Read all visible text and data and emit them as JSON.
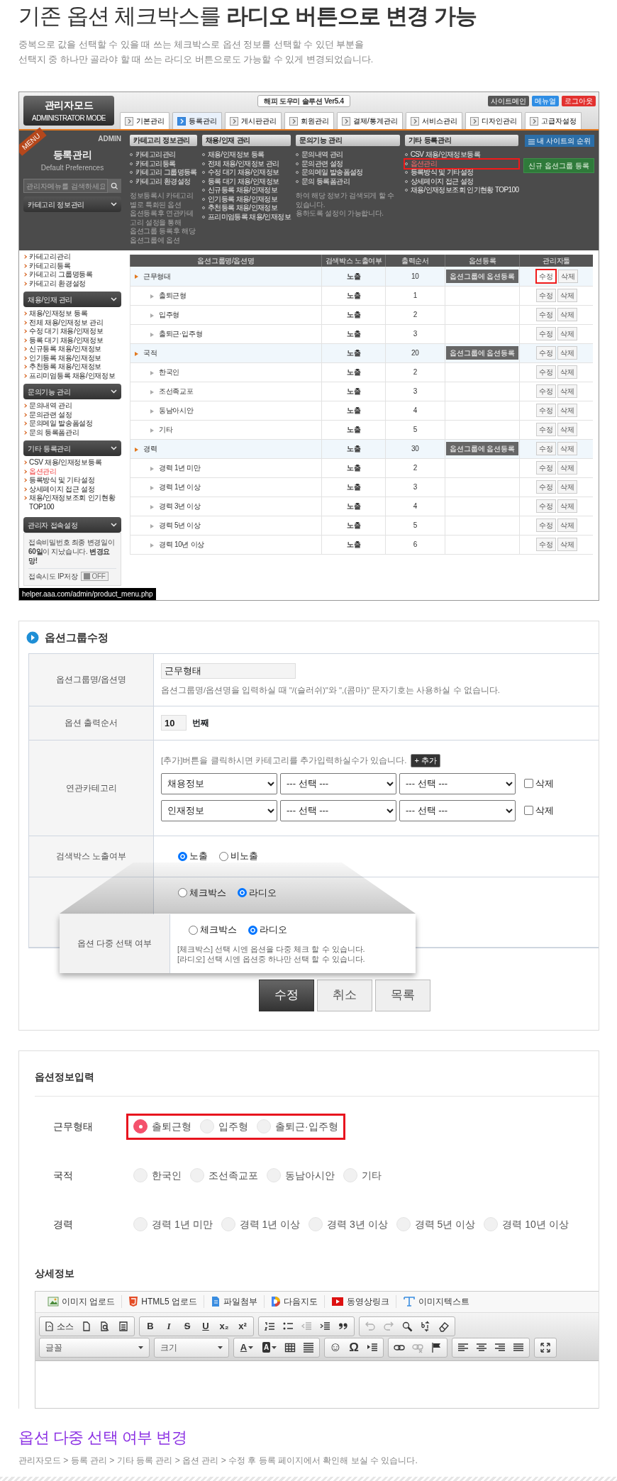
{
  "intro": {
    "title": "기존 옵션 체크박스를 **라디오 버튼으로 변경 가능**",
    "lines": [
      "중복으로 값을 선택할 수 있을 때 쓰는 체크박스로 옵션 정보를 선택할 수 있던 부분을",
      "선택지 중 하나만 골라야 할 때 쓰는 라디오 버튼으로도 가능할 수 있게 변경되었습니다."
    ]
  },
  "admin_screen": {
    "logo": {
      "title": "관리자모드",
      "subtitle": "ADMINISTRATOR MODE"
    },
    "product_title": "해피 도우미 솔루션 Ver5.4",
    "top_buttons": [
      {
        "label": "사이트메인",
        "kind": "dark"
      },
      {
        "label": "메뉴얼",
        "kind": "blue"
      },
      {
        "label": "로그아웃",
        "kind": "red"
      }
    ],
    "tabs": [
      {
        "label": "기본관리",
        "selected": false
      },
      {
        "label": "등록관리",
        "selected": true
      },
      {
        "label": "게시판관리",
        "selected": false
      },
      {
        "label": "회원관리",
        "selected": false
      },
      {
        "label": "결제/통계관리",
        "selected": false
      },
      {
        "label": "서비스관리",
        "selected": false
      },
      {
        "label": "디자인관리",
        "selected": false
      },
      {
        "label": "고급자설정",
        "selected": false
      }
    ],
    "rank_button": "내 사이트의 순위",
    "menus": [
      {
        "title": "카테고리 정보관리",
        "items": [
          {
            "label": "카테고리관리",
            "boxed": false
          },
          {
            "label": "카테고리등록",
            "boxed": false
          },
          {
            "label": "카테고리 그룹명등록",
            "boxed": false
          },
          {
            "label": "카테고리 환경설정",
            "boxed": false
          }
        ],
        "notes": [
          "정보등록시 카테고리별로 특화된 옵션",
          "옵션등록후 연관카테고리 설정을 통해",
          "옵션그룹 등록후 해당 옵션그룹에 옵션"
        ]
      },
      {
        "title": "채용/인재 관리",
        "items": [
          {
            "label": "채용/인재정보 등록",
            "boxed": false
          },
          {
            "label": "전체 채용/인재정보 관리",
            "boxed": false
          },
          {
            "label": "수정 대기 채용/인재정보",
            "boxed": false
          },
          {
            "label": "등록 대기 채용/인재정보",
            "boxed": false
          },
          {
            "label": "신규등록 채용/인재정보",
            "boxed": false
          },
          {
            "label": "인기등록 채용/인재정보",
            "boxed": false
          },
          {
            "label": "추천등록 채용/인재정보",
            "boxed": false
          },
          {
            "label": "프리미엄등록 채용/인재정보",
            "boxed": false
          }
        ]
      },
      {
        "title": "문의기능 관리",
        "items": [
          {
            "label": "문의내역 관리",
            "boxed": false
          },
          {
            "label": "문의관련 설정",
            "boxed": false
          },
          {
            "label": "문의메일 발송폼설정",
            "boxed": false
          },
          {
            "label": "문의 등록폼관리",
            "boxed": false
          }
        ],
        "notes": [
          "하여 해당 정보가 검색되게 할 수 있습니다.",
          "용하도록 설정이 가능합니다."
        ]
      },
      {
        "title": "기타 등록관리",
        "items": [
          {
            "label": "CSV 채용/인재정보등록",
            "boxed": false
          },
          {
            "label": "옵션관리",
            "boxed": true
          },
          {
            "label": "등록방식 및 기타설정",
            "boxed": false
          },
          {
            "label": "상세페이지 접근 설정",
            "boxed": false
          },
          {
            "label": "채용/인재정보조회 인기현황 TOP100",
            "boxed": false
          }
        ]
      }
    ],
    "new_group_button": "신규 옵션그룹 등록",
    "sidebar": {
      "ribbon": "MENU",
      "corner": "ADMIN",
      "title": "등록관리",
      "subtitle": "Default Preferences",
      "search_placeholder": "관리자메뉴를 검색하세요",
      "sections": [
        {
          "title": "카테고리 정보관리",
          "items": [
            {
              "label": "카테고리관리",
              "selected": false
            },
            {
              "label": "카테고리등록",
              "selected": false
            },
            {
              "label": "카테고리 그룹명등록",
              "selected": false
            },
            {
              "label": "카테고리 환경설정",
              "selected": false
            }
          ]
        },
        {
          "title": "채용/인재 관리",
          "items": [
            {
              "label": "채용/인재정보 등록",
              "selected": false
            },
            {
              "label": "전체 채용/인재정보 관리",
              "selected": false
            },
            {
              "label": "수정 대기 채용/인재정보",
              "selected": false
            },
            {
              "label": "등록 대기 채용/인재정보",
              "selected": false
            },
            {
              "label": "신규등록 채용/인재정보",
              "selected": false
            },
            {
              "label": "인기등록 채용/인재정보",
              "selected": false
            },
            {
              "label": "추천등록 채용/인재정보",
              "selected": false
            },
            {
              "label": "프리미엄등록 채용/인재정보",
              "selected": false
            }
          ]
        },
        {
          "title": "문의기능 관리",
          "items": [
            {
              "label": "문의내역 관리",
              "selected": false
            },
            {
              "label": "문의관련 설정",
              "selected": false
            },
            {
              "label": "문의메일 발송폼설정",
              "selected": false
            },
            {
              "label": "문의 등록폼관리",
              "selected": false
            }
          ]
        },
        {
          "title": "기타 등록관리",
          "items": [
            {
              "label": "CSV 채용/인재정보등록",
              "selected": false
            },
            {
              "label": "옵션관리",
              "selected": true
            },
            {
              "label": "등록방식 및 기타설정",
              "selected": false
            },
            {
              "label": "상세페이지 접근 설정",
              "selected": false
            },
            {
              "label": "채용/인재정보조회 인기현황 TOP100",
              "selected": false
            }
          ]
        }
      ],
      "access": {
        "title": "관리자 접속설정",
        "notice": "접속비밀번호 최종 변경일이 **60일**이 지났습니다. **변경요망!**",
        "ip_label": "접속시도 IP저장",
        "toggle": {
          "label": "OFF",
          "on": false
        }
      }
    },
    "table": {
      "columns": [
        "옵션그룹명/옵션명",
        "검색박스 노출여부",
        "출력순서",
        "옵션등록",
        "관리자툴"
      ],
      "rows": [
        {
          "name": "근무형태",
          "exposure": "노출",
          "order": "10",
          "register_button": "옵션그룹에 옵션등록",
          "edit": "수정",
          "delete": "삭제",
          "edit_boxed": true,
          "children": [
            {
              "name": "출퇴근형",
              "exposure": "노출",
              "order": "1",
              "edit": "수정",
              "delete": "삭제",
              "edit_boxed": false
            },
            {
              "name": "입주형",
              "exposure": "노출",
              "order": "2",
              "edit": "수정",
              "delete": "삭제",
              "edit_boxed": false
            },
            {
              "name": "출퇴근·입주형",
              "exposure": "노출",
              "order": "3",
              "edit": "수정",
              "delete": "삭제",
              "edit_boxed": false
            }
          ]
        },
        {
          "name": "국적",
          "exposure": "노출",
          "order": "20",
          "register_button": "옵션그룹에 옵션등록",
          "edit": "수정",
          "delete": "삭제",
          "edit_boxed": false,
          "children": [
            {
              "name": "한국인",
              "exposure": "노출",
              "order": "2",
              "edit": "수정",
              "delete": "삭제",
              "edit_boxed": false
            },
            {
              "name": "조선족교포",
              "exposure": "노출",
              "order": "3",
              "edit": "수정",
              "delete": "삭제",
              "edit_boxed": false
            },
            {
              "name": "동남아시안",
              "exposure": "노출",
              "order": "4",
              "edit": "수정",
              "delete": "삭제",
              "edit_boxed": false
            },
            {
              "name": "기타",
              "exposure": "노출",
              "order": "5",
              "edit": "수정",
              "delete": "삭제",
              "edit_boxed": false
            }
          ]
        },
        {
          "name": "경력",
          "exposure": "노출",
          "order": "30",
          "register_button": "옵션그룹에 옵션등록",
          "edit": "수정",
          "delete": "삭제",
          "edit_boxed": false,
          "children": [
            {
              "name": "경력 1년 미만",
              "exposure": "노출",
              "order": "2",
              "edit": "수정",
              "delete": "삭제",
              "edit_boxed": false
            },
            {
              "name": "경력 1년 이상",
              "exposure": "노출",
              "order": "3",
              "edit": "수정",
              "delete": "삭제",
              "edit_boxed": false
            },
            {
              "name": "경력 3년 이상",
              "exposure": "노출",
              "order": "4",
              "edit": "수정",
              "delete": "삭제",
              "edit_boxed": false
            },
            {
              "name": "경력 5년 이상",
              "exposure": "노출",
              "order": "5",
              "edit": "수정",
              "delete": "삭제",
              "edit_boxed": false
            },
            {
              "name": "경력 10년 이상",
              "exposure": "노출",
              "order": "6",
              "edit": "수정",
              "delete": "삭제",
              "edit_boxed": false
            }
          ]
        }
      ]
    },
    "status_bar": "helper.aaa.com/admin/product_menu.php"
  },
  "option_group_form": {
    "title": "옵션그룹수정",
    "rows": [
      {
        "kind": "name",
        "label": "옵션그룹명/옵션명",
        "value": "근무형태",
        "hint": "옵션그룹명/옵션명을 입력하실 때 \"/(슬러쉬)\"와 \",(콤마)\" 문자기호는 사용하실 수 없습니다."
      },
      {
        "kind": "order",
        "label": "옵션 출력순서",
        "value": "10",
        "suffix": "번째"
      },
      {
        "kind": "category",
        "label": "연관카테고리",
        "hint": "[추가]버튼을 클릭하시면 카테고리를 추가입력하실수가 있습니다.",
        "add_button": "+ 추가",
        "lines": [
          {
            "selects": [
              "채용정보",
              "--- 선택 ---",
              "--- 선택 ---"
            ],
            "delete": {
              "label": "삭제",
              "checked": false
            }
          },
          {
            "selects": [
              "인재정보",
              "--- 선택 ---",
              "--- 선택 ---"
            ],
            "delete": {
              "label": "삭제",
              "checked": false
            }
          }
        ]
      },
      {
        "kind": "radio",
        "label": "검색박스 노출여부",
        "options": [
          {
            "label": "노출",
            "selected": true
          },
          {
            "label": "비노출",
            "selected": false
          }
        ]
      },
      {
        "kind": "radio",
        "options": [
          {
            "label": "체크박스",
            "selected": false
          },
          {
            "label": "라디오",
            "selected": true
          }
        ]
      }
    ],
    "callout": {
      "label": "옵션 다중 선택 여부",
      "options": [
        {
          "label": "체크박스",
          "selected": false
        },
        {
          "label": "라디오",
          "selected": true
        }
      ],
      "hints": [
        "[체크박스] 선택 시엔 옵션을 다중 체크 할 수 있습니다.",
        "[라디오] 선택 시엔 옵션중 하나만 선택 할 수 있습니다."
      ]
    },
    "buttons": [
      {
        "label": "수정",
        "kind": "primary"
      },
      {
        "label": "취소",
        "kind": "plain"
      },
      {
        "label": "목록",
        "kind": "plain"
      }
    ]
  },
  "option_input": {
    "title": "옵션정보입력",
    "groups": [
      {
        "label": "근무형태",
        "boxed": true,
        "options": [
          {
            "label": "출퇴근형",
            "selected": true
          },
          {
            "label": "입주형",
            "selected": false
          },
          {
            "label": "출퇴근·입주형",
            "selected": false
          }
        ]
      },
      {
        "label": "국적",
        "boxed": false,
        "options": [
          {
            "label": "한국인",
            "selected": false
          },
          {
            "label": "조선족교포",
            "selected": false
          },
          {
            "label": "동남아시안",
            "selected": false
          },
          {
            "label": "기타",
            "selected": false
          }
        ]
      },
      {
        "label": "경력",
        "boxed": false,
        "options": [
          {
            "label": "경력 1년 미만",
            "selected": false
          },
          {
            "label": "경력 1년 이상",
            "selected": false
          },
          {
            "label": "경력 3년 이상",
            "selected": false
          },
          {
            "label": "경력 5년 이상",
            "selected": false
          },
          {
            "label": "경력 10년 이상",
            "selected": false
          }
        ]
      }
    ],
    "detail_title": "상세정보",
    "editor": {
      "attachments": [
        {
          "label": "이미지 업로드",
          "kind": "image"
        },
        {
          "label": "HTML5 업로드",
          "kind": "html5"
        },
        {
          "label": "파일첨부",
          "kind": "file"
        },
        {
          "label": "다음지도",
          "kind": "map"
        },
        {
          "label": "동영상링크",
          "kind": "video"
        },
        {
          "label": "이미지텍스트",
          "kind": "textimage"
        }
      ],
      "toolbar_rows": [
        [
          [
            {
              "kind": "source",
              "label": "소스",
              "disabled": false
            },
            {
              "kind": "newpage",
              "disabled": false
            },
            {
              "kind": "preview",
              "disabled": false
            },
            {
              "kind": "template",
              "disabled": false
            }
          ],
          [
            {
              "kind": "bold",
              "label": "B",
              "disabled": false
            },
            {
              "kind": "italic",
              "label": "I",
              "disabled": false
            },
            {
              "kind": "strike",
              "label": "S",
              "disabled": false
            },
            {
              "kind": "underline",
              "label": "U",
              "disabled": false
            },
            {
              "kind": "sub",
              "label": "x₂",
              "disabled": false
            },
            {
              "kind": "sup",
              "label": "x²",
              "disabled": false
            }
          ],
          [
            {
              "kind": "ol",
              "disabled": false
            },
            {
              "kind": "ul",
              "disabled": false
            },
            {
              "kind": "outdent",
              "disabled": true
            },
            {
              "kind": "indent",
              "disabled": false
            },
            {
              "kind": "blockquote",
              "disabled": false
            }
          ],
          [
            {
              "kind": "undo",
              "disabled": true
            },
            {
              "kind": "redo",
              "disabled": true
            },
            {
              "kind": "find",
              "disabled": false
            },
            {
              "kind": "replace",
              "disabled": false
            },
            {
              "kind": "eraser",
              "disabled": false
            }
          ]
        ],
        [
          [
            {
              "kind": "dropdown",
              "label": "글꼴",
              "disabled": false
            }
          ],
          [
            {
              "kind": "dropdown",
              "label": "크기",
              "disabled": false
            }
          ],
          [
            {
              "kind": "textcolor",
              "label": "A",
              "disabled": false
            },
            {
              "kind": "bgcolor",
              "label": "A",
              "disabled": false
            },
            {
              "kind": "table",
              "disabled": false
            },
            {
              "kind": "hr",
              "disabled": false
            }
          ],
          [
            {
              "kind": "smiley",
              "label": "☺",
              "disabled": false
            },
            {
              "kind": "special",
              "label": "Ω",
              "disabled": false
            },
            {
              "kind": "pagebreak",
              "disabled": false
            }
          ],
          [
            {
              "kind": "link",
              "disabled": false
            },
            {
              "kind": "unlink",
              "disabled": true
            },
            {
              "kind": "anchor",
              "disabled": false
            }
          ],
          [
            {
              "kind": "alignleft",
              "disabled": false
            },
            {
              "kind": "aligncenter",
              "disabled": false
            },
            {
              "kind": "alignright",
              "disabled": false
            },
            {
              "kind": "justify",
              "disabled": false
            }
          ],
          [
            {
              "kind": "maximize",
              "disabled": false
            }
          ]
        ]
      ]
    }
  },
  "summary": {
    "title": "옵션 다중 선택 여부 변경",
    "path": "관리자모드 > 등록 관리 > 기타 등록 관리 > 옵션 관리 > 수정 후 등록 페이지에서 확인해 보실 수 있습니다."
  }
}
